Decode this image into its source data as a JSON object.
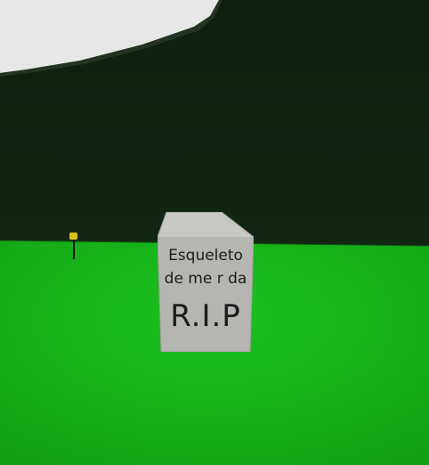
{
  "scene": {
    "colors": {
      "sky_band": "#e6e6e6",
      "hill": "#10210f",
      "grass": "#17b61a",
      "tombstone": "#b7b7b4",
      "tombstone_top": "#c9c9c6",
      "engraving": "#1c1c1c",
      "torch_flame": "#d7c21e"
    },
    "tombstone": {
      "line1": "Esqueleto",
      "line2": "de me r da",
      "rip": "R.I.P"
    },
    "torch_icon": "torch-icon"
  }
}
